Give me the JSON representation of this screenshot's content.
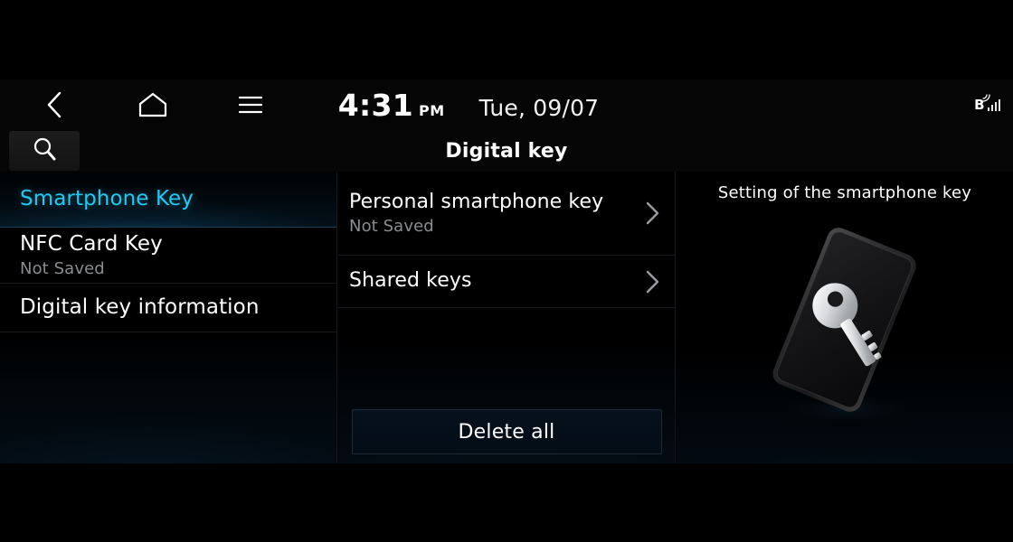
{
  "statusbar": {
    "back_icon": "chevron-left-icon",
    "home_icon": "home-icon",
    "menu_icon": "hamburger-menu-icon",
    "time": "4:31",
    "ampm": "PM",
    "date": "Tue, 09/07",
    "bluetooth_glyph": "B",
    "signal_icon": "signal-bars-icon"
  },
  "titlebar": {
    "search_icon": "search-icon",
    "title": "Digital key"
  },
  "sidebar": {
    "items": [
      {
        "label": "Smartphone Key",
        "sub": "",
        "selected": true
      },
      {
        "label": "NFC Card Key",
        "sub": "Not Saved",
        "selected": false
      },
      {
        "label": "Digital key information",
        "sub": "",
        "selected": false
      }
    ]
  },
  "midpanel": {
    "rows": [
      {
        "label": "Personal smartphone key",
        "sub": "Not Saved",
        "chevron": "chevron-right-icon"
      },
      {
        "label": "Shared keys",
        "sub": "",
        "chevron": "chevron-right-icon"
      }
    ],
    "delete_all_label": "Delete all"
  },
  "rightpanel": {
    "title": "Setting of the smartphone key",
    "illustration": "smartphone-with-key-icon"
  },
  "colors": {
    "accent_cyan": "#23c8f0",
    "text_primary": "#ffffff",
    "text_secondary": "#8a8d91",
    "background": "#000000"
  }
}
